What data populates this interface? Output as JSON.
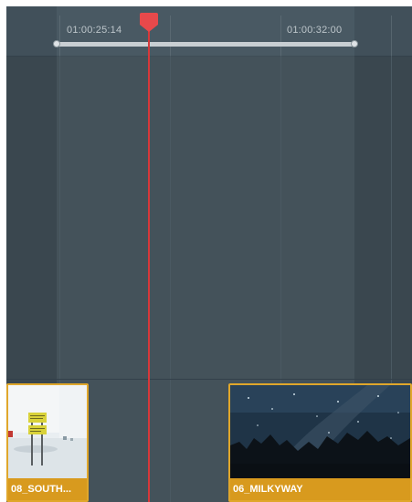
{
  "timeline": {
    "timecodes": [
      "01:00:25:14",
      "01:00:32:00"
    ]
  },
  "clips": [
    {
      "name": "08_SOUTH..."
    },
    {
      "name": "06_MILKYWAY"
    }
  ],
  "colors": {
    "playhead": "#e8494b",
    "clip_selected_border": "#e0a72b",
    "track_background": "#3a474f"
  }
}
